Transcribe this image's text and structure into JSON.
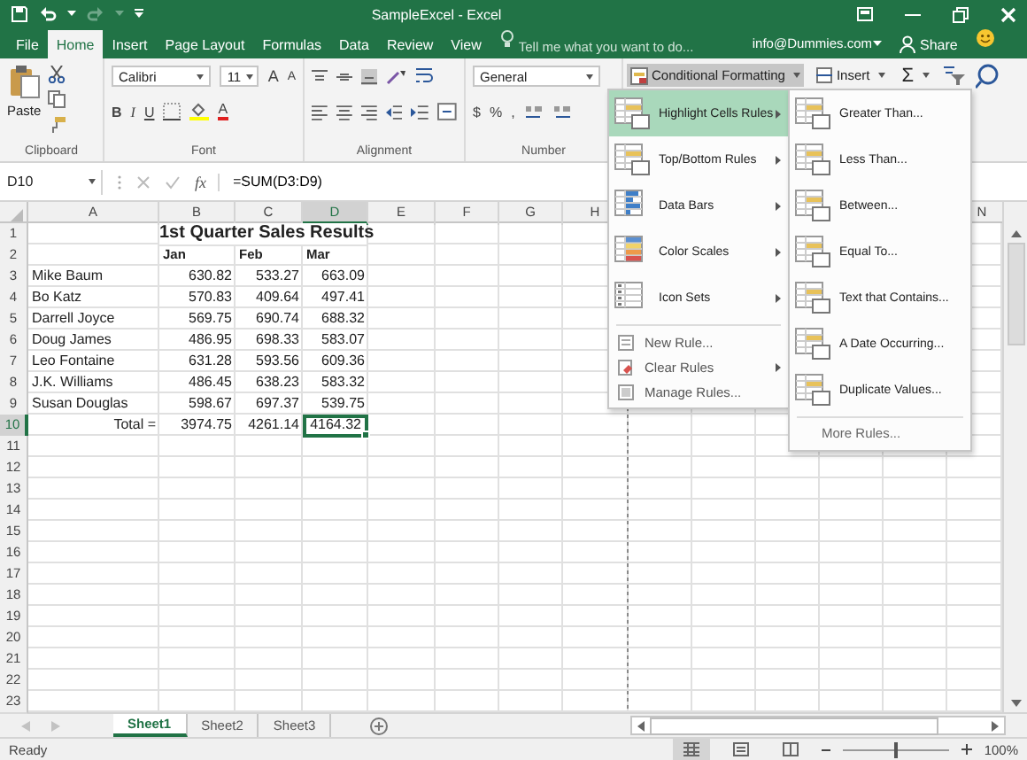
{
  "title_bar": {
    "title": "SampleExcel - Excel"
  },
  "tabs": [
    {
      "label": "File",
      "selected": false
    },
    {
      "label": "Home",
      "selected": true
    },
    {
      "label": "Insert",
      "selected": false
    },
    {
      "label": "Page Layout",
      "selected": false
    },
    {
      "label": "Formulas",
      "selected": false
    },
    {
      "label": "Data",
      "selected": false
    },
    {
      "label": "Review",
      "selected": false
    },
    {
      "label": "View",
      "selected": false
    }
  ],
  "tell_me": {
    "placeholder": "Tell me what you want to do..."
  },
  "account": "info@Dummies.com",
  "share": "Share",
  "ribbon": {
    "clipboard": {
      "paste": "Paste",
      "label": "Clipboard"
    },
    "font": {
      "name": "Calibri",
      "size": "11",
      "grow": "A",
      "shrink": "A",
      "bold": "B",
      "italic": "I",
      "underline": "U",
      "color_letter": "A",
      "label": "Font"
    },
    "alignment": {
      "label": "Alignment"
    },
    "number": {
      "format": "General",
      "currency": "$",
      "percent": "%",
      "comma": ",",
      "label": "Number"
    },
    "conditional": {
      "label": "Conditional Formatting",
      "expanded": true
    },
    "insert": "Insert",
    "sum": "Σ"
  },
  "formula_bar": {
    "name_box": "D10",
    "fx": "fx",
    "formula": "=SUM(D3:D9)"
  },
  "sheet": {
    "columns": [
      {
        "label": "A",
        "selected": false
      },
      {
        "label": "B",
        "selected": false
      },
      {
        "label": "C",
        "selected": false
      },
      {
        "label": "D",
        "selected": true
      },
      {
        "label": "E",
        "selected": false
      },
      {
        "label": "F",
        "selected": false
      },
      {
        "label": "G",
        "selected": false
      },
      {
        "label": "H",
        "selected": false
      },
      {
        "label": "N",
        "selected": false
      }
    ],
    "rows": [
      {
        "number": "1",
        "kind": "title",
        "title": "1st Quarter Sales Results"
      },
      {
        "number": "2",
        "kind": "header",
        "cells": [
          {
            "text": "Jan",
            "selected": false
          },
          {
            "text": "Feb",
            "selected": false
          },
          {
            "text": "Mar",
            "selected": false
          }
        ]
      },
      {
        "number": "3",
        "kind": "data",
        "label": "Mike Baum",
        "cells": [
          {
            "text": "630.82",
            "selected": false
          },
          {
            "text": "533.27",
            "selected": false
          },
          {
            "text": "663.09",
            "selected": false
          }
        ]
      },
      {
        "number": "4",
        "kind": "data",
        "label": "Bo Katz",
        "cells": [
          {
            "text": "570.83",
            "selected": false
          },
          {
            "text": "409.64",
            "selected": false
          },
          {
            "text": "497.41",
            "selected": false
          }
        ]
      },
      {
        "number": "5",
        "kind": "data",
        "label": "Darrell Joyce",
        "cells": [
          {
            "text": "569.75",
            "selected": false
          },
          {
            "text": "690.74",
            "selected": false
          },
          {
            "text": "688.32",
            "selected": false
          }
        ]
      },
      {
        "number": "6",
        "kind": "data",
        "label": "Doug James",
        "cells": [
          {
            "text": "486.95",
            "selected": false
          },
          {
            "text": "698.33",
            "selected": false
          },
          {
            "text": "583.07",
            "selected": false
          }
        ]
      },
      {
        "number": "7",
        "kind": "data",
        "label": "Leo Fontaine",
        "cells": [
          {
            "text": "631.28",
            "selected": false
          },
          {
            "text": "593.56",
            "selected": false
          },
          {
            "text": "609.36",
            "selected": false
          }
        ]
      },
      {
        "number": "8",
        "kind": "data",
        "label": "J.K. Williams",
        "cells": [
          {
            "text": "486.45",
            "selected": false
          },
          {
            "text": "638.23",
            "selected": false
          },
          {
            "text": "583.32",
            "selected": false
          }
        ]
      },
      {
        "number": "9",
        "kind": "data",
        "label": "Susan Douglas",
        "cells": [
          {
            "text": "598.67",
            "selected": false
          },
          {
            "text": "697.37",
            "selected": false
          },
          {
            "text": "539.75",
            "selected": false
          }
        ]
      },
      {
        "number": "10",
        "kind": "total",
        "label": "Total =",
        "cells": [
          {
            "text": "3974.75",
            "selected": false
          },
          {
            "text": "4261.14",
            "selected": false
          },
          {
            "text": "4164.32",
            "selected": true
          }
        ]
      },
      {
        "number": "11",
        "kind": "empty"
      },
      {
        "number": "12",
        "kind": "empty"
      },
      {
        "number": "13",
        "kind": "empty"
      },
      {
        "number": "14",
        "kind": "empty"
      },
      {
        "number": "15",
        "kind": "empty"
      },
      {
        "number": "16",
        "kind": "empty"
      },
      {
        "number": "17",
        "kind": "empty"
      },
      {
        "number": "18",
        "kind": "empty"
      },
      {
        "number": "19",
        "kind": "empty"
      },
      {
        "number": "20",
        "kind": "empty"
      },
      {
        "number": "21",
        "kind": "empty"
      },
      {
        "number": "22",
        "kind": "empty"
      },
      {
        "number": "23",
        "kind": "empty"
      }
    ]
  },
  "menu": {
    "items": [
      {
        "label": "Highlight Cells Rules",
        "kind": "highlight",
        "submenu": true,
        "selected": true
      },
      {
        "label": "Top/Bottom Rules",
        "kind": "topbottom",
        "submenu": true,
        "selected": false
      },
      {
        "label": "Data Bars",
        "kind": "databars",
        "submenu": true,
        "selected": false
      },
      {
        "label": "Color Scales",
        "kind": "colorscales",
        "submenu": true,
        "selected": false
      },
      {
        "label": "Icon Sets",
        "kind": "iconsets",
        "submenu": true,
        "selected": false
      },
      {
        "label": "New Rule...",
        "kind": "new",
        "submenu": false,
        "selected": false
      },
      {
        "label": "Clear Rules",
        "kind": "clear",
        "submenu": true,
        "selected": false
      },
      {
        "label": "Manage Rules...",
        "kind": "manage",
        "submenu": false,
        "selected": false
      }
    ]
  },
  "submenu": {
    "items": [
      {
        "label": "Greater Than..."
      },
      {
        "label": "Less Than..."
      },
      {
        "label": "Between..."
      },
      {
        "label": "Equal To..."
      },
      {
        "label": "Text that Contains..."
      },
      {
        "label": "A Date Occurring..."
      },
      {
        "label": "Duplicate Values..."
      }
    ],
    "more": "More Rules..."
  },
  "sheet_tabs": [
    {
      "label": "Sheet1",
      "selected": true
    },
    {
      "label": "Sheet2",
      "selected": false
    },
    {
      "label": "Sheet3",
      "selected": false
    }
  ],
  "status": {
    "text": "Ready",
    "views": [
      {
        "kind": "normal",
        "selected": true
      },
      {
        "kind": "layout",
        "selected": false
      },
      {
        "kind": "break",
        "selected": false
      }
    ],
    "zoom": {
      "level": 0.5,
      "reading": "100%"
    }
  }
}
